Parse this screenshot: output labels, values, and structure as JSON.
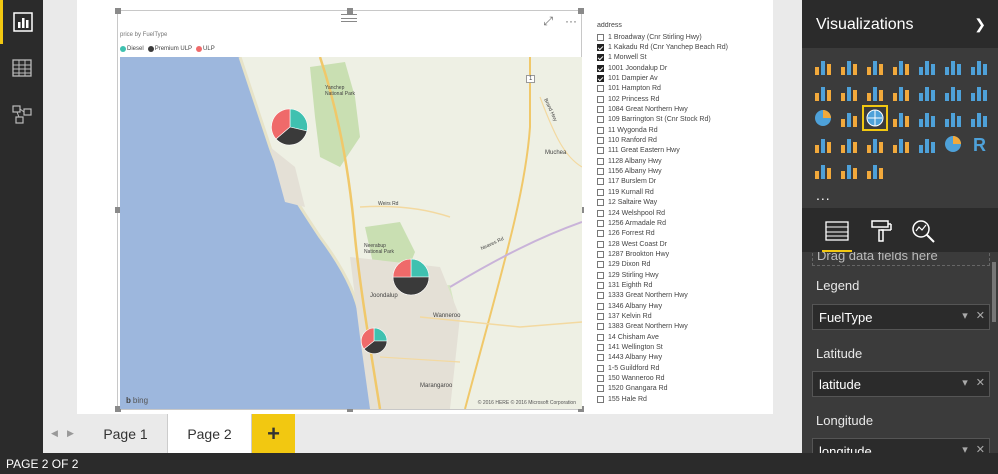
{
  "rail": {
    "items": [
      {
        "name": "report-view",
        "icon": "bar-chart-icon",
        "active": true
      },
      {
        "name": "data-view",
        "icon": "table-icon",
        "active": false
      },
      {
        "name": "relationships-view",
        "icon": "relationships-icon",
        "active": false
      }
    ]
  },
  "visual": {
    "title": "price by FuelType",
    "legend": [
      {
        "label": "Diesel",
        "color": "#3fc1b0"
      },
      {
        "label": "Premium ULP",
        "color": "#3a3a3a"
      },
      {
        "label": "ULP",
        "color": "#ef6a6a"
      }
    ],
    "map": {
      "labels": {
        "yanchep": "Yanchep National Park",
        "muchea": "Muchea",
        "neerabup": "Neerabup National Park",
        "joondalup": "Joondalup",
        "wanneroo": "Wanneroo",
        "marangaroo": "Marangaroo",
        "weirs_rd": "Weirs Rd",
        "neaves_rd": "Neaves Rd",
        "brand_hwy": "Brand Hwy",
        "road_1": "1"
      },
      "copyright": "© 2016 HERE   © 2016 Microsoft Corporation",
      "provider": "bing"
    }
  },
  "slicer": {
    "header": "address",
    "items": [
      {
        "label": "1 Broadway (Cnr Stirling Hwy)",
        "checked": false
      },
      {
        "label": "1 Kakadu Rd (Cnr Yanchep Beach Rd)",
        "checked": true
      },
      {
        "label": "1 Morwell St",
        "checked": true
      },
      {
        "label": "1001 Joondalup Dr",
        "checked": true
      },
      {
        "label": "101 Dampier Av",
        "checked": true
      },
      {
        "label": "101 Hampton Rd",
        "checked": false
      },
      {
        "label": "102 Princess Rd",
        "checked": false
      },
      {
        "label": "1084 Great Northern Hwy",
        "checked": false
      },
      {
        "label": "109 Barrington St (Cnr Stock Rd)",
        "checked": false
      },
      {
        "label": "11 Wygonda Rd",
        "checked": false
      },
      {
        "label": "110 Ranford Rd",
        "checked": false
      },
      {
        "label": "111 Great Eastern Hwy",
        "checked": false
      },
      {
        "label": "1128 Albany Hwy",
        "checked": false
      },
      {
        "label": "1156 Albany Hwy",
        "checked": false
      },
      {
        "label": "117 Burslem Dr",
        "checked": false
      },
      {
        "label": "119 Kurnall Rd",
        "checked": false
      },
      {
        "label": "12 Saltaire Way",
        "checked": false
      },
      {
        "label": "124 Welshpool Rd",
        "checked": false
      },
      {
        "label": "1256 Armadale Rd",
        "checked": false
      },
      {
        "label": "126 Forrest Rd",
        "checked": false
      },
      {
        "label": "128 West Coast Dr",
        "checked": false
      },
      {
        "label": "1287 Brookton Hwy",
        "checked": false
      },
      {
        "label": "129 Dixon Rd",
        "checked": false
      },
      {
        "label": "129 Stirling Hwy",
        "checked": false
      },
      {
        "label": "131 Eighth Rd",
        "checked": false
      },
      {
        "label": "1333 Great Northern Hwy",
        "checked": false
      },
      {
        "label": "1346 Albany Hwy",
        "checked": false
      },
      {
        "label": "137 Kelvin Rd",
        "checked": false
      },
      {
        "label": "1383 Great Northern Hwy",
        "checked": false
      },
      {
        "label": "14 Chisham Ave",
        "checked": false
      },
      {
        "label": "141 Wellington St",
        "checked": false
      },
      {
        "label": "1443 Albany Hwy",
        "checked": false
      },
      {
        "label": "1-5 Guildford Rd",
        "checked": false
      },
      {
        "label": "150 Wanneroo Rd",
        "checked": false
      },
      {
        "label": "1520 Gnangara Rd",
        "checked": false
      },
      {
        "label": "155 Hale Rd",
        "checked": false
      }
    ]
  },
  "tabs": {
    "pages": [
      {
        "label": "Page 1",
        "active": false
      },
      {
        "label": "Page 2",
        "active": true
      }
    ],
    "add_label": "+"
  },
  "status": {
    "text": "PAGE 2 OF 2"
  },
  "pane": {
    "title": "Visualizations",
    "more_label": "...",
    "drop_hint": "Drag data fields here",
    "wells": [
      {
        "label": "Legend",
        "value": "FuelType"
      },
      {
        "label": "Latitude",
        "value": "latitude"
      },
      {
        "label": "Longitude",
        "value": "longitude"
      }
    ]
  },
  "colors": {
    "accent": "#f2c811",
    "diesel": "#3fc1b0",
    "premium": "#3a3a3a",
    "ulp": "#ef6a6a"
  }
}
